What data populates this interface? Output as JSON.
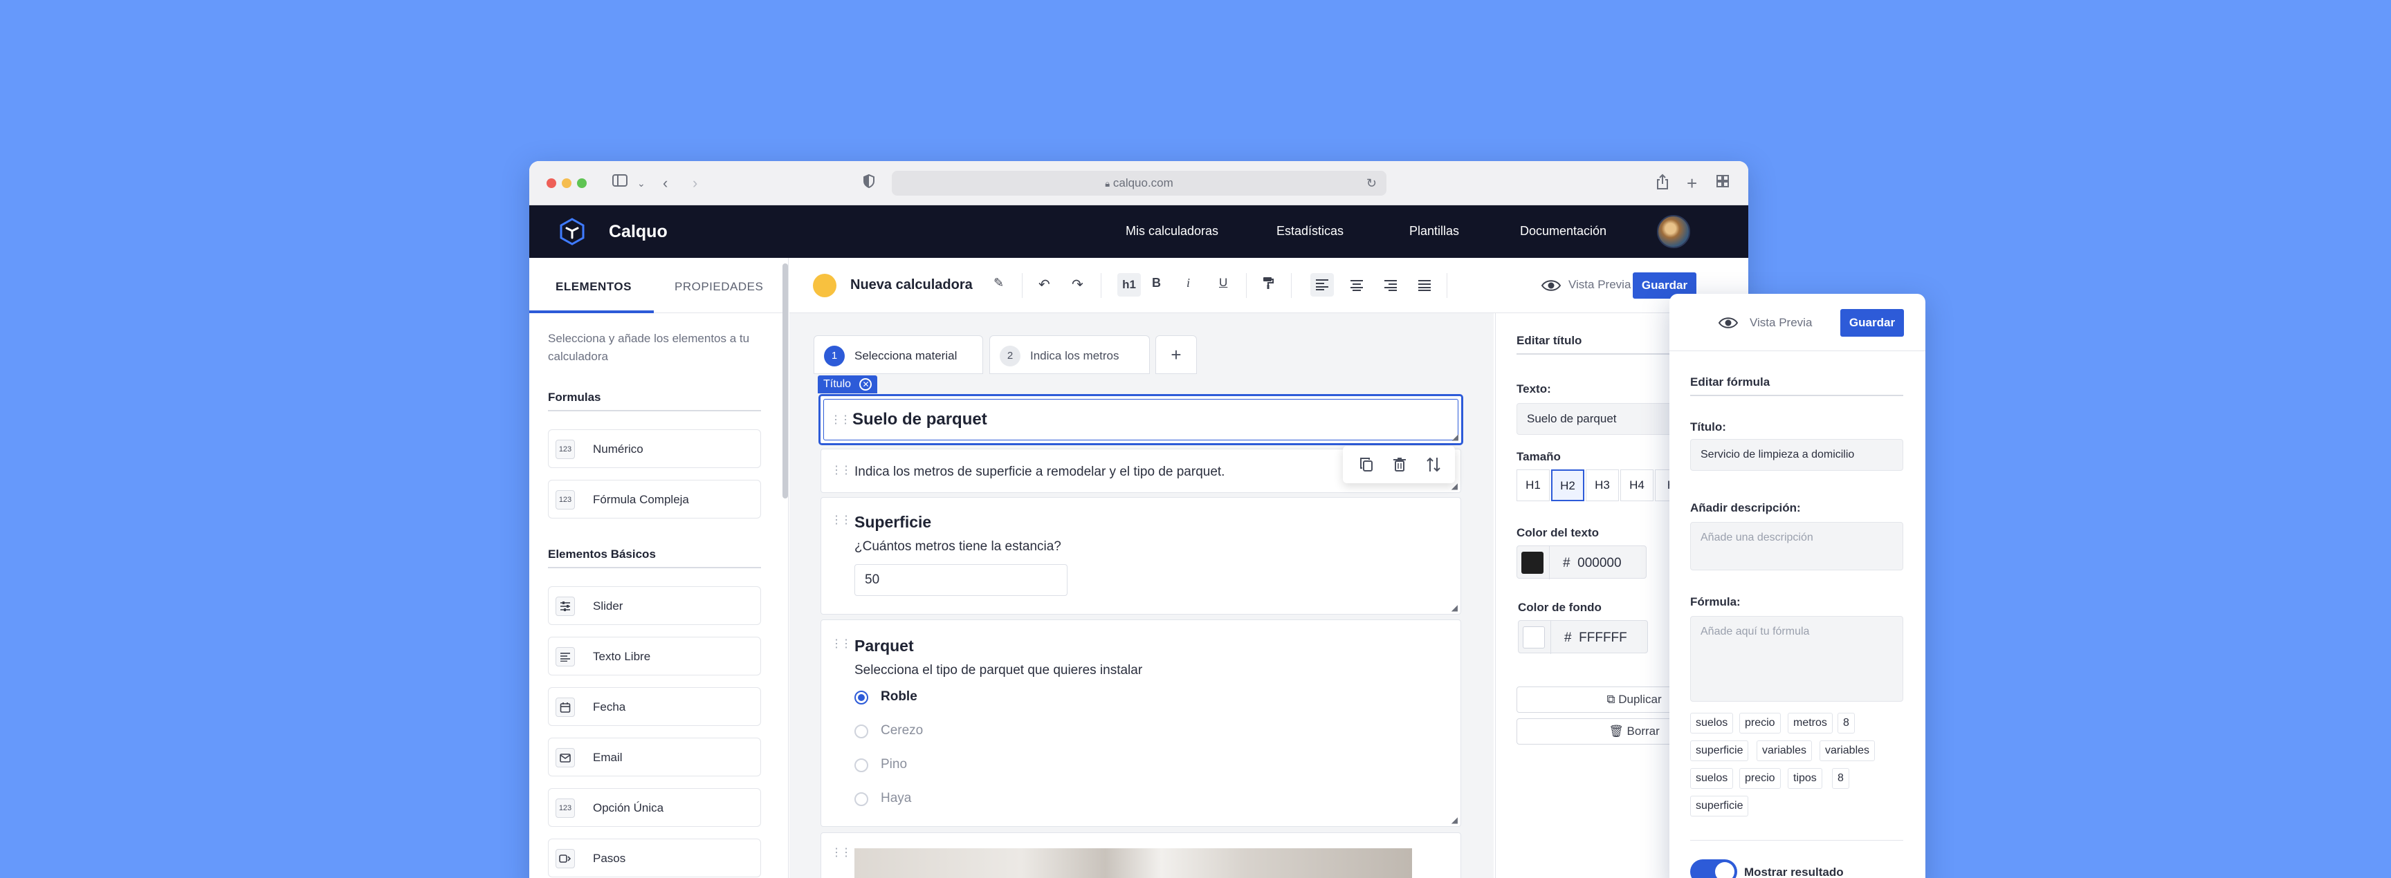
{
  "browser": {
    "url": "calquo.com"
  },
  "app": {
    "brand": "Calquo",
    "nav": [
      "Mis calculadoras",
      "Estadísticas",
      "Plantillas",
      "Documentación"
    ]
  },
  "sidebar": {
    "tabs": [
      "ELEMENTOS",
      "PROPIEDADES"
    ],
    "description": "Selecciona y añade los elementos a tu calculadora",
    "sections": [
      {
        "title": "Formulas",
        "items": [
          {
            "icon": "123",
            "label": "Numérico"
          },
          {
            "icon": "123",
            "label": "Fórmula Compleja"
          }
        ]
      },
      {
        "title": "Elementos Básicos",
        "items": [
          {
            "icon": "sliders-icon",
            "label": "Slider"
          },
          {
            "icon": "text-align-icon",
            "label": "Texto Libre"
          },
          {
            "icon": "calendar-icon",
            "label": "Fecha"
          },
          {
            "icon": "mail-icon",
            "label": "Email"
          },
          {
            "icon": "123",
            "label": "Opción Única"
          },
          {
            "icon": "steps-icon",
            "label": "Pasos"
          }
        ]
      }
    ]
  },
  "toolbar": {
    "title": "Nueva calculadora",
    "heading_btn": "h1",
    "bold_btn": "B",
    "italic_btn": "i",
    "underline_btn": "U",
    "preview_label": "Vista Previa",
    "save_label": "Guardar"
  },
  "steps": [
    {
      "num": "1",
      "label": "Selecciona material",
      "active": true
    },
    {
      "num": "2",
      "label": "Indica los metros",
      "active": false
    }
  ],
  "selected_tag": "Título",
  "blocks": {
    "title": "Suelo de parquet",
    "intro": "Indica los metros de superficie a remodelar y el tipo de parquet.",
    "superficie": {
      "title": "Superficie",
      "question": "¿Cuántos metros tiene la estancia?",
      "value": "50"
    },
    "parquet": {
      "title": "Parquet",
      "question": "Selecciona el tipo de parquet que quieres instalar",
      "options": [
        "Roble",
        "Cerezo",
        "Pino",
        "Haya"
      ],
      "selected": "Roble"
    }
  },
  "props": {
    "heading": "Editar título",
    "text_label": "Texto:",
    "text_value": "Suelo de parquet",
    "size_label": "Tamaño",
    "sizes": [
      "H1",
      "H2",
      "H3",
      "H4",
      "H"
    ],
    "selected_size": "H2",
    "text_color_label": "Color del texto",
    "text_color_hex": "000000",
    "text_color": "#1f1f1f",
    "bg_color_label": "Color de fondo",
    "bg_color_hex": "FFFFFF",
    "bg_color": "#ffffff",
    "duplicate_label": "Duplicar",
    "delete_label": "Borrar"
  },
  "formula_panel": {
    "preview_label": "Vista Previa",
    "save_label": "Guardar",
    "heading": "Editar fórmula",
    "title_label": "Título:",
    "title_value": "Servicio de limpieza a domicilio",
    "desc_label": "Añadir descripción:",
    "desc_placeholder": "Añade una descripción",
    "formula_label": "Fórmula:",
    "formula_placeholder": "Añade aquí tu fórmula",
    "chips": [
      [
        "suelos",
        "precio",
        "metros",
        "8"
      ],
      [
        "superficie",
        "variables",
        "variables"
      ],
      [
        "suelos",
        "precio",
        "tipos",
        "8"
      ],
      [
        "superficie"
      ]
    ],
    "toggle_label": "Mostrar resultado",
    "toggle_on": true
  },
  "colors": {
    "background": "#6699fb",
    "accent": "#2d5bd8",
    "nav_bg": "#111426",
    "title_dot": "#f8c13f"
  }
}
